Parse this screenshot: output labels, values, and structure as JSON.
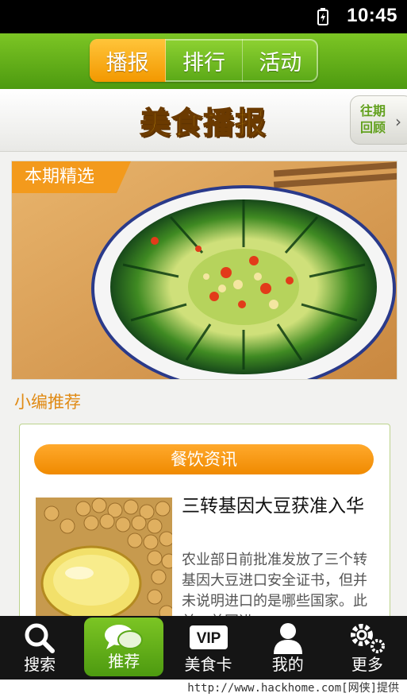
{
  "status_bar": {
    "time": "10:45",
    "battery_icon": "battery-charging-icon"
  },
  "top_tabs": [
    {
      "label": "播报",
      "active": true
    },
    {
      "label": "排行",
      "active": false
    },
    {
      "label": "活动",
      "active": false
    }
  ],
  "banner": {
    "title": "美食播报",
    "past_button": "往期回顾"
  },
  "featured": {
    "tag": "本期精选"
  },
  "section_label": "小编推荐",
  "card": {
    "header": "餐饮资讯",
    "news_title": "三转基因大豆获准入华",
    "news_summary": "农业部日前批准发放了三个转基因大豆进口安全证书，但并未说明进口的是哪些国家。此前，美国进"
  },
  "bottom_nav": [
    {
      "label": "搜索",
      "icon": "search-icon",
      "active": false
    },
    {
      "label": "推荐",
      "icon": "chat-bubbles-icon",
      "active": true
    },
    {
      "label": "美食卡",
      "icon": "vip-card-icon",
      "active": false
    },
    {
      "label": "我的",
      "icon": "person-icon",
      "active": false
    },
    {
      "label": "更多",
      "icon": "gears-icon",
      "active": false
    }
  ],
  "vip_badge": "VIP",
  "watermark": "http://www.hackhome.com[网侠]提供",
  "colors": {
    "green": "#5aa817",
    "orange": "#f39800",
    "nav_bg": "#151515"
  }
}
